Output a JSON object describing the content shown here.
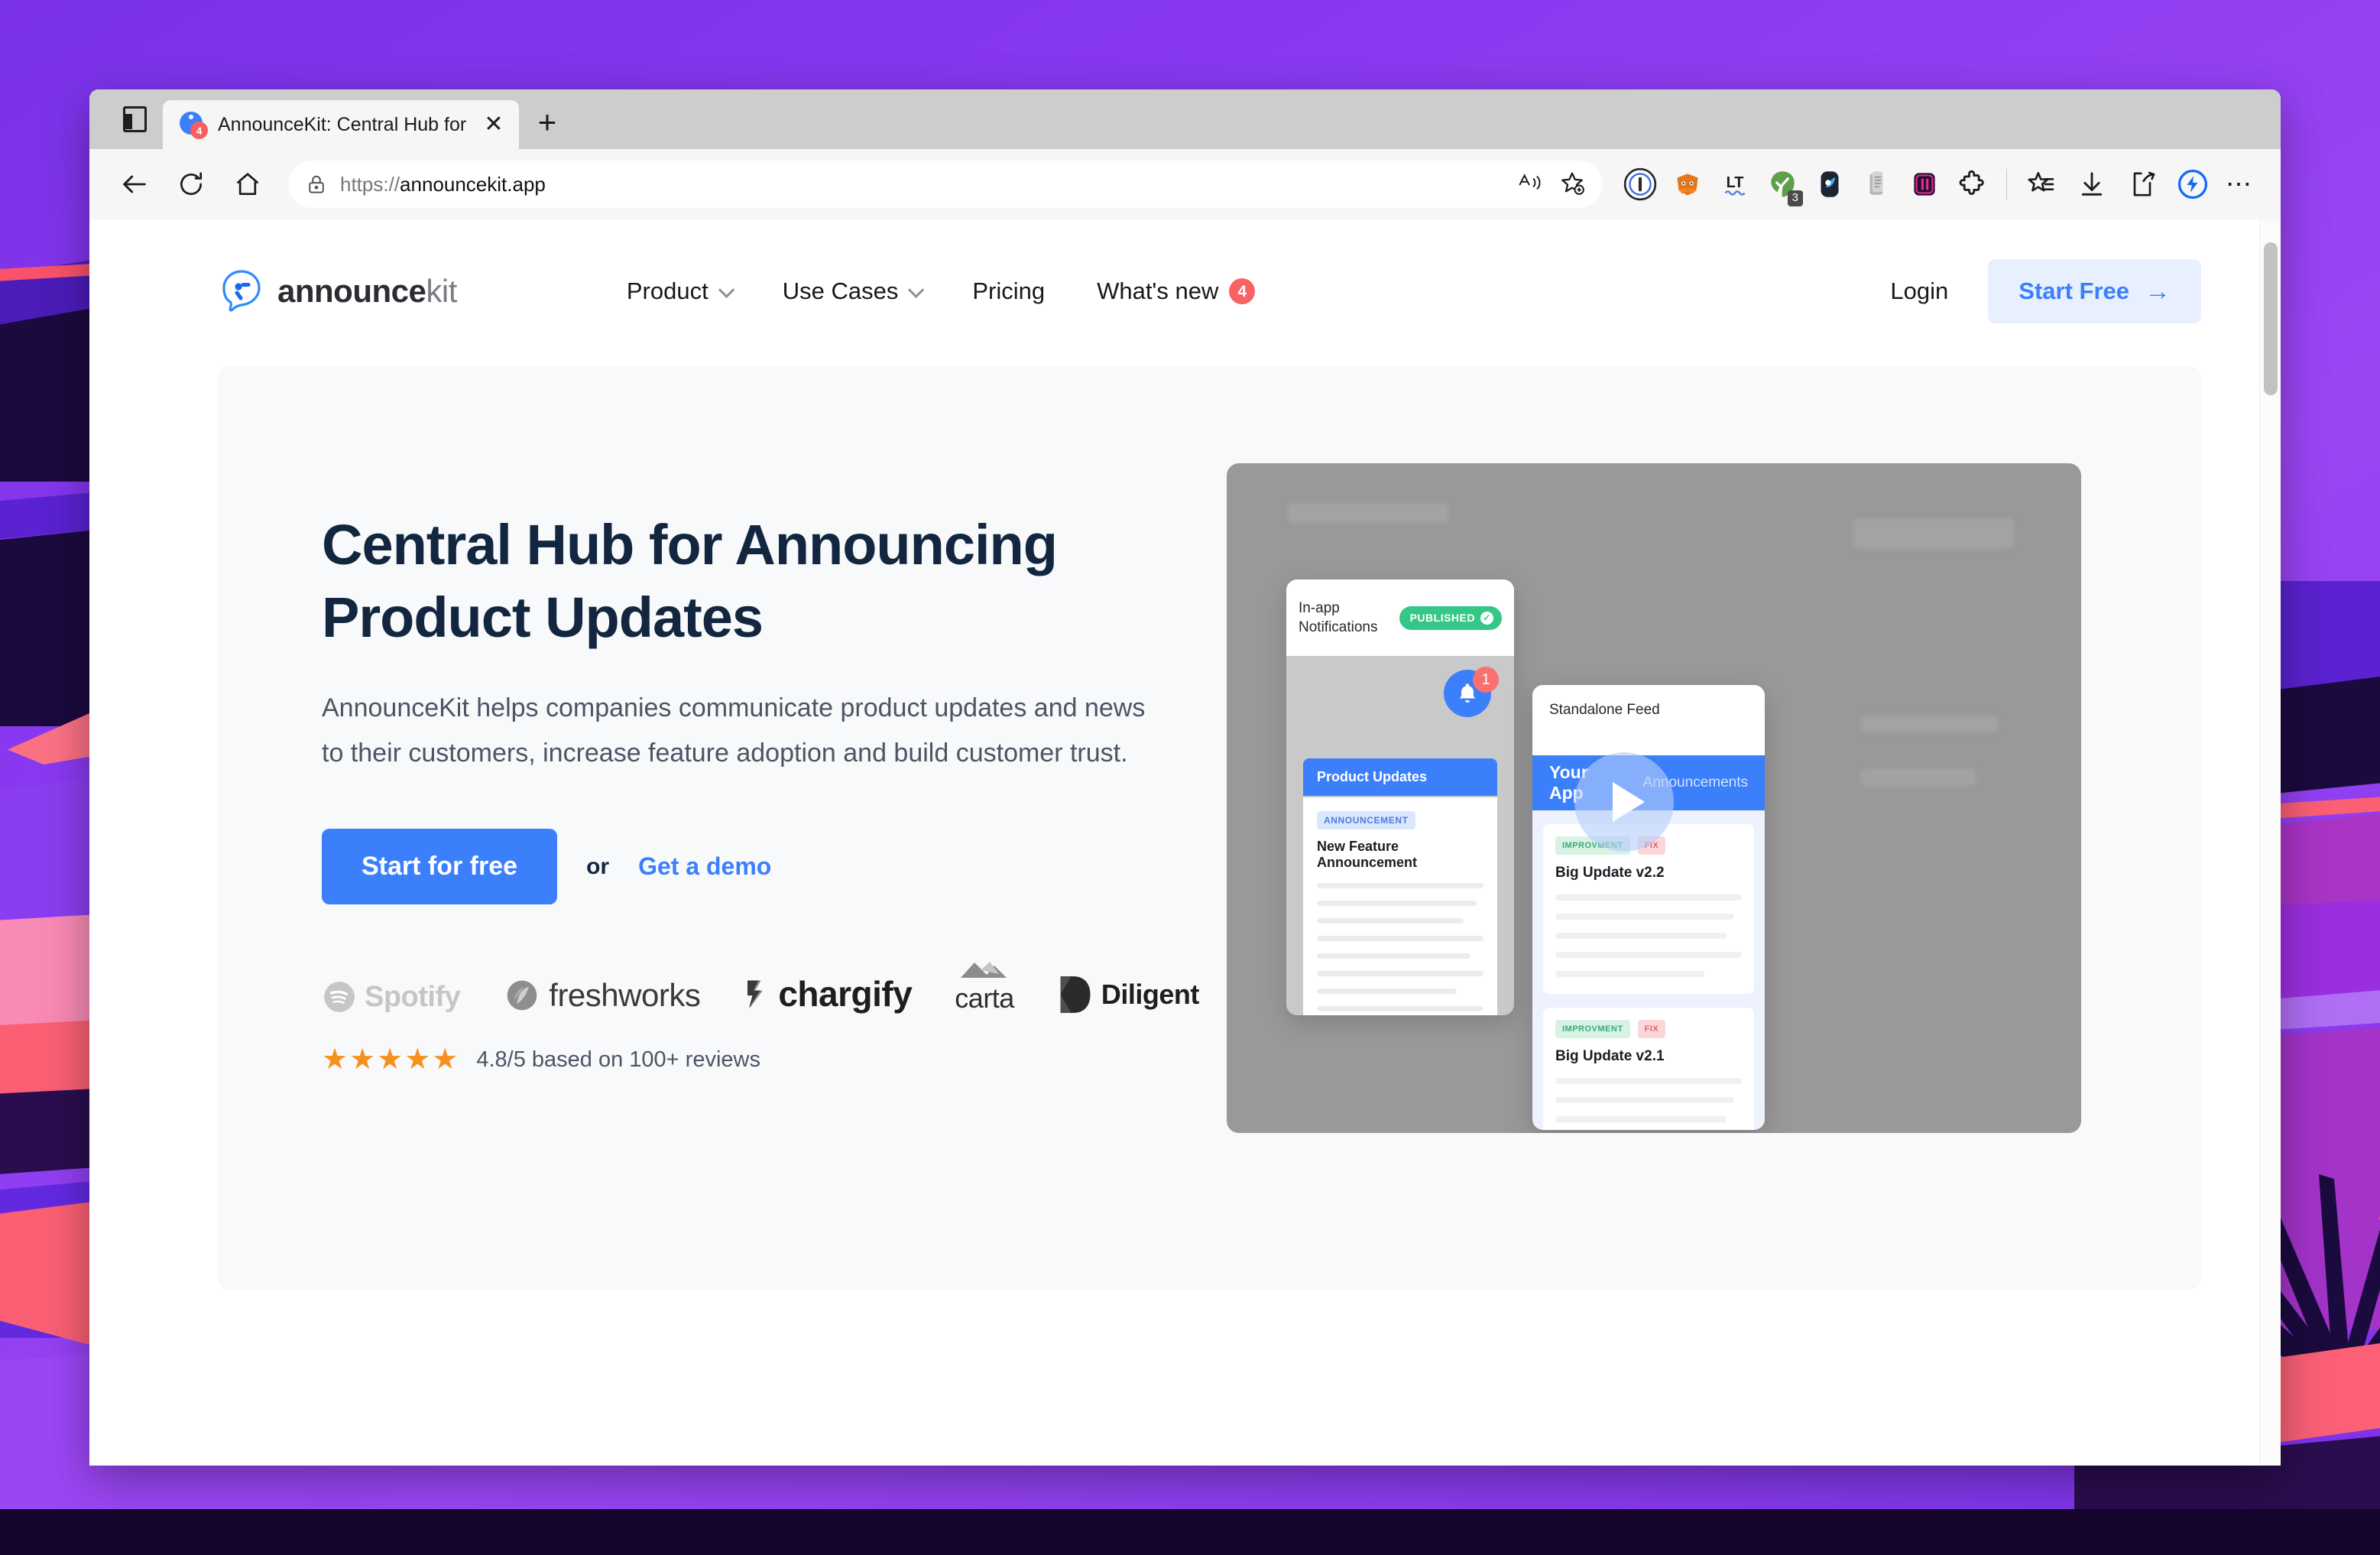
{
  "browser": {
    "tab": {
      "title": "AnnounceKit: Central Hub for A",
      "favicon_badge": "4",
      "close_glyph": "✕"
    },
    "new_tab_glyph": "+",
    "toolbar": {
      "back_label": "Back",
      "reload_label": "Reload",
      "home_label": "Home",
      "url_scheme": "https://",
      "url_host": "announcekit.app",
      "read_aloud_label": "Read aloud",
      "favorite_label": "Add to favorites",
      "extensions": [
        {
          "name": "onepassword-extension-icon",
          "badge": ""
        },
        {
          "name": "metamask-extension-icon",
          "badge": ""
        },
        {
          "name": "languagetool-extension-icon",
          "badge": ""
        },
        {
          "name": "grammarly-extension-icon",
          "badge": "3"
        },
        {
          "name": "dark-reader-extension-icon",
          "badge": ""
        },
        {
          "name": "clipboard-extension-icon",
          "badge": ""
        },
        {
          "name": "magenta-extension-icon",
          "badge": ""
        },
        {
          "name": "extensions-puzzle-icon",
          "badge": ""
        }
      ],
      "collections_label": "Collections",
      "downloads_label": "Downloads",
      "share_label": "Share",
      "copilot_label": "Copilot",
      "settings_glyph": "⋯"
    }
  },
  "site": {
    "logo": {
      "name": "announce",
      "suffix": "kit"
    },
    "nav": [
      {
        "label": "Product",
        "has_chevron": true,
        "badge": ""
      },
      {
        "label": "Use Cases",
        "has_chevron": true,
        "badge": ""
      },
      {
        "label": "Pricing",
        "has_chevron": false,
        "badge": ""
      },
      {
        "label": "What's new",
        "has_chevron": false,
        "badge": "4"
      }
    ],
    "login_label": "Login",
    "start_free_label": "Start Free",
    "start_free_arrow": "→"
  },
  "hero": {
    "heading": "Central Hub for Announcing Product Updates",
    "subheading": "AnnounceKit helps companies communicate product updates and news to their customers, increase feature adoption and build customer trust.",
    "primary_cta": "Start for free",
    "or_label": "or",
    "secondary_cta": "Get a demo",
    "customer_logos": [
      "Spotify",
      "freshworks",
      "chargify",
      "carta",
      "Diligent"
    ],
    "rating": {
      "stars": "★★★★★",
      "text": "4.8/5 based on 100+ reviews"
    }
  },
  "hero_image": {
    "left_card": {
      "title": "In-app Notifications",
      "status_badge": "PUBLISHED",
      "status_check": "✓",
      "bell_badge": "1",
      "widget_header": "Product Updates",
      "tag": "ANNOUNCEMENT",
      "item_title": "New Feature Announcement"
    },
    "right_card": {
      "title": "Standalone Feed",
      "app_name": "Your App",
      "tab_label": "Announcements",
      "items": [
        {
          "tags": [
            "IMPROVMENT",
            "FIX"
          ],
          "title": "Big Update v2.2"
        },
        {
          "tags": [
            "IMPROVMENT",
            "FIX"
          ],
          "title": "Big Update v2.1"
        }
      ]
    }
  },
  "colors": {
    "brand_blue": "#3b7ffb",
    "cta_light": "#e8effe",
    "headline_navy": "#12273f",
    "badge_red": "#f96262",
    "published_green": "#34c785",
    "star_orange": "#f5921e",
    "hero_bg": "#f8f9fb"
  }
}
